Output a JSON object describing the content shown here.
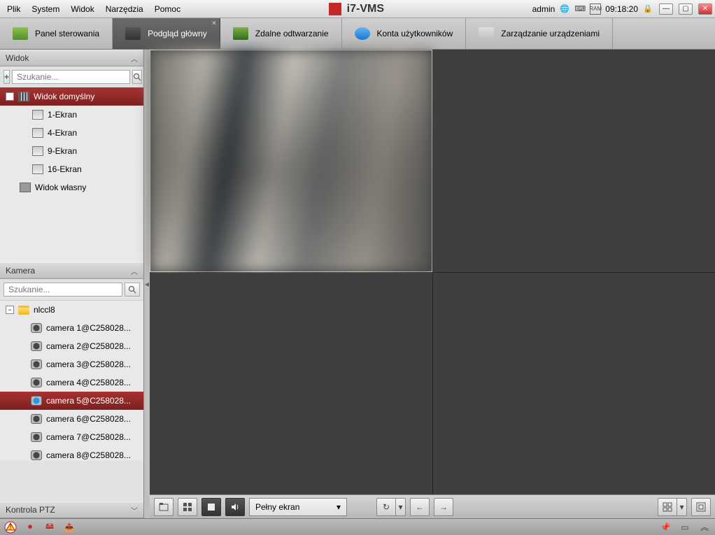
{
  "app": {
    "title": "i7-VMS"
  },
  "menubar": {
    "items": [
      "Plik",
      "System",
      "Widok",
      "Narzędzia",
      "Pomoc"
    ]
  },
  "header_right": {
    "user": "admin",
    "time": "09:18:20"
  },
  "toolbar": {
    "tabs": [
      {
        "label": "Panel sterowania"
      },
      {
        "label": "Podgląd główny",
        "active": true
      },
      {
        "label": "Zdalne odtwarzanie"
      },
      {
        "label": "Konta użytkowników"
      },
      {
        "label": "Zarządzanie urządzeniami"
      }
    ]
  },
  "panels": {
    "view": {
      "title": "Widok",
      "search_placeholder": "Szukanie...",
      "default_view": "Widok domyślny",
      "screens": [
        "1-Ekran",
        "4-Ekran",
        "9-Ekran",
        "16-Ekran"
      ],
      "custom_view": "Widok własny"
    },
    "camera": {
      "title": "Kamera",
      "search_placeholder": "Szukanie...",
      "group": "nlccl8",
      "cameras": [
        "camera 1@C258028...",
        "camera 2@C258028...",
        "camera 3@C258028...",
        "camera 4@C258028...",
        "camera 5@C258028...",
        "camera 6@C258028...",
        "camera 7@C258028...",
        "camera 8@C258028..."
      ],
      "selected_index": 4
    },
    "ptz": {
      "title": "Kontrola PTZ"
    }
  },
  "controls": {
    "fullscreen_label": "Pełny ekran"
  }
}
